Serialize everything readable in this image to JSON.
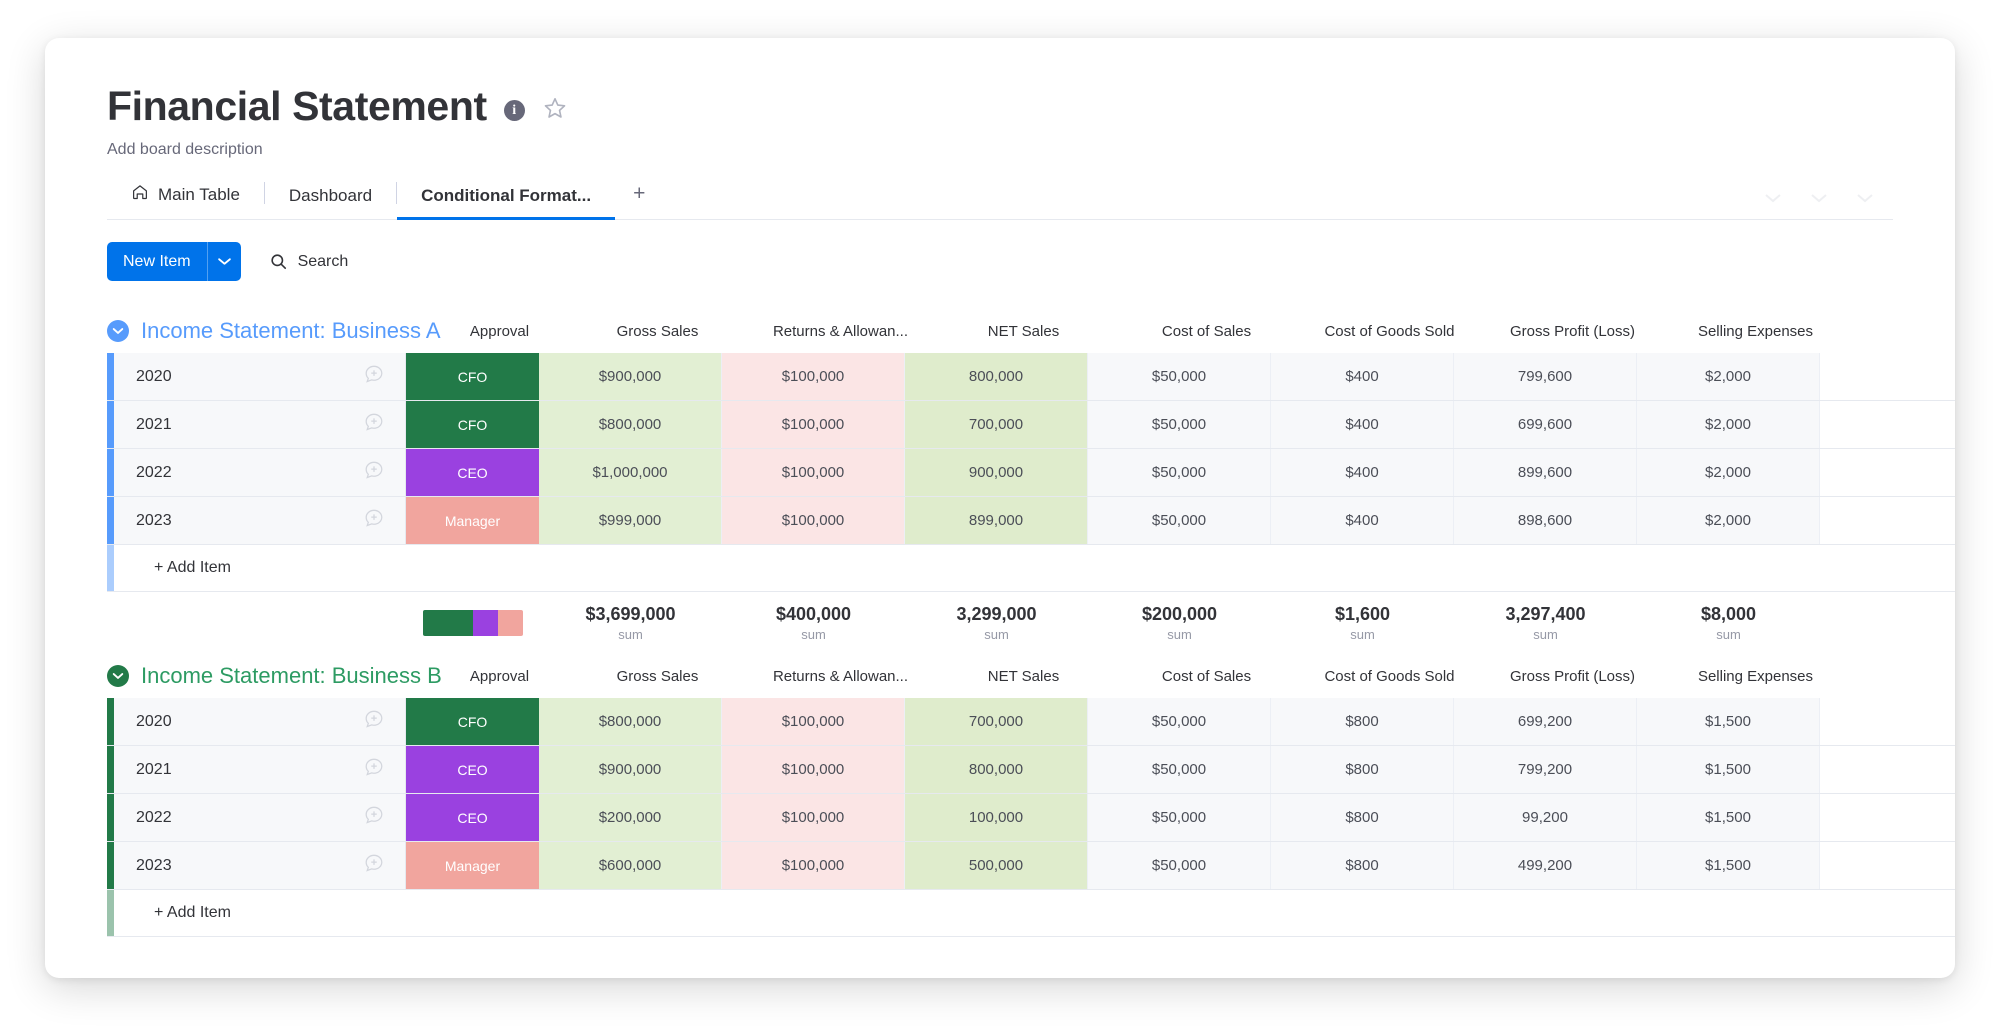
{
  "header": {
    "title": "Financial Statement",
    "info_icon": "info-icon",
    "star_icon": "star-icon",
    "description": "Add board description"
  },
  "tabs": [
    {
      "label": "Main Table",
      "icon": "home-icon",
      "active": false
    },
    {
      "label": "Dashboard",
      "icon": "",
      "active": false
    },
    {
      "label": "Conditional Format...",
      "icon": "",
      "active": true
    }
  ],
  "tab_add_label": "+",
  "toolbar": {
    "new_item_label": "New Item",
    "new_item_caret": "chevron-down-icon",
    "search_label": "Search",
    "search_icon": "search-icon"
  },
  "colors": {
    "accent_blue": "#0073ea",
    "group_a": "#579bfc",
    "group_b": "#227a48",
    "status_cfo": "#227a48",
    "status_ceo": "#9a41e0",
    "status_manager": "#f1a59e",
    "cell_green": "#e2efd3",
    "cell_red": "#fbe5e5",
    "cell_grey": "#f7f8fa"
  },
  "columns": [
    {
      "key": "approval",
      "label": "Approval"
    },
    {
      "key": "gross",
      "label": "Gross Sales"
    },
    {
      "key": "returns",
      "label": "Returns & Allowan..."
    },
    {
      "key": "net",
      "label": "NET Sales"
    },
    {
      "key": "cos",
      "label": "Cost of Sales"
    },
    {
      "key": "cogs",
      "label": "Cost of Goods Sold"
    },
    {
      "key": "gp",
      "label": "Gross Profit (Loss)"
    },
    {
      "key": "sell",
      "label": "Selling Expenses"
    }
  ],
  "add_item_label": "+ Add Item",
  "summary_sub_label": "sum",
  "groups": [
    {
      "title": "Income Statement: Business A",
      "accent": "#579bfc",
      "collapse_icon": "chevron-down-circle-icon",
      "items": [
        {
          "name": "2020",
          "approval": "CFO",
          "approval_color": "#227a48",
          "gross": "$900,000",
          "returns": "$100,000",
          "net": "800,000",
          "cos": "$50,000",
          "cogs": "$400",
          "gp": "799,600",
          "sell": "$2,000"
        },
        {
          "name": "2021",
          "approval": "CFO",
          "approval_color": "#227a48",
          "gross": "$800,000",
          "returns": "$100,000",
          "net": "700,000",
          "cos": "$50,000",
          "cogs": "$400",
          "gp": "699,600",
          "sell": "$2,000"
        },
        {
          "name": "2022",
          "approval": "CEO",
          "approval_color": "#9a41e0",
          "gross": "$1,000,000",
          "returns": "$100,000",
          "net": "900,000",
          "cos": "$50,000",
          "cogs": "$400",
          "gp": "899,600",
          "sell": "$2,000"
        },
        {
          "name": "2023",
          "approval": "Manager",
          "approval_color": "#f1a59e",
          "gross": "$999,000",
          "returns": "$100,000",
          "net": "899,000",
          "cos": "$50,000",
          "cogs": "$400",
          "gp": "898,600",
          "sell": "$2,000"
        }
      ],
      "summary": {
        "approval_bar": [
          {
            "color": "#227a48",
            "pct": 50
          },
          {
            "color": "#9a41e0",
            "pct": 25
          },
          {
            "color": "#f1a59e",
            "pct": 25
          }
        ],
        "gross": "$3,699,000",
        "returns": "$400,000",
        "net": "3,299,000",
        "cos": "$200,000",
        "cogs": "$1,600",
        "gp": "3,297,400",
        "sell": "$8,000"
      }
    },
    {
      "title": "Income Statement: Business B",
      "accent": "#227a48",
      "collapse_icon": "chevron-down-circle-icon",
      "items": [
        {
          "name": "2020",
          "approval": "CFO",
          "approval_color": "#227a48",
          "gross": "$800,000",
          "returns": "$100,000",
          "net": "700,000",
          "cos": "$50,000",
          "cogs": "$800",
          "gp": "699,200",
          "sell": "$1,500"
        },
        {
          "name": "2021",
          "approval": "CEO",
          "approval_color": "#9a41e0",
          "gross": "$900,000",
          "returns": "$100,000",
          "net": "800,000",
          "cos": "$50,000",
          "cogs": "$800",
          "gp": "799,200",
          "sell": "$1,500"
        },
        {
          "name": "2022",
          "approval": "CEO",
          "approval_color": "#9a41e0",
          "gross": "$200,000",
          "returns": "$100,000",
          "net": "100,000",
          "cos": "$50,000",
          "cogs": "$800",
          "gp": "99,200",
          "sell": "$1,500"
        },
        {
          "name": "2023",
          "approval": "Manager",
          "approval_color": "#f1a59e",
          "gross": "$600,000",
          "returns": "$100,000",
          "net": "500,000",
          "cos": "$50,000",
          "cogs": "$800",
          "gp": "499,200",
          "sell": "$1,500"
        }
      ]
    }
  ]
}
